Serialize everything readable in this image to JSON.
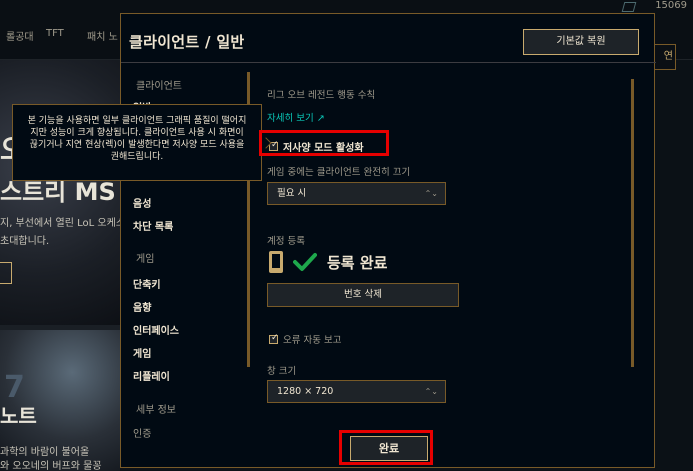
{
  "background": {
    "nav_items": [
      "롤공대",
      "TFT",
      "패치 노"
    ],
    "currency_value": "15069",
    "hero_headline_1": "오",
    "hero_headline_2": "스트리 MS",
    "hero_text_1": "지, 부선에서 열린 LoL 오케스",
    "hero_text_2": "초대합니다.",
    "right_partial_button": "연",
    "card_number": "7",
    "card_title": "노트",
    "card_sub_1": "과학의 바람이 불어올",
    "card_sub_2": "와 오오네의 버프와 물꽁"
  },
  "modal": {
    "title": "클라이언트 / 일반",
    "reset_button": "기본값 복원",
    "done_button": "완료"
  },
  "sidebar": {
    "client_header": "클라이언트",
    "partial_item": "일반",
    "items_client": [
      "음성",
      "차단 목록"
    ],
    "game_header": "게임",
    "items_game": [
      "단축키",
      "음향",
      "인터페이스",
      "게임",
      "리플레이"
    ],
    "details_header": "세부 정보",
    "details_item": "인증"
  },
  "tooltip": {
    "text": "본 기능을 사용하면 일부 클라이언트 그래픽 품질이 떨어지지만 성능이 크게 향상됩니다. 클라이언트 사용 시 화면이 끊기거나 지연 현상(렉)이 발생한다면 저사양 모드 사용을 권해드립니다."
  },
  "content": {
    "conduct_label": "리그 오브 레전드 행동 수칙",
    "conduct_link": "자세히 보기 ↗",
    "low_spec_label": "저사양 모드 활성화",
    "low_spec_checked": true,
    "close_client_label": "게임 중에는 클라이언트 완전히 끄기",
    "close_client_value": "필요 시",
    "account_label": "계정 등록",
    "verified_text": "등록 완료",
    "remove_number_button": "번호 삭제",
    "error_report_label": "오류 자동 보고",
    "error_report_checked": true,
    "window_size_label": "창 크기",
    "window_size_value": "1280 × 720"
  },
  "colors": {
    "gold": "#c8aa6e",
    "gold_dark": "#785a28",
    "text_light": "#f0e6d2",
    "text_muted": "#a09b8c",
    "link_teal": "#0ac8b9",
    "check_green": "#1ea84c",
    "highlight_red": "#e60000",
    "panel_bg": "#010a13"
  }
}
